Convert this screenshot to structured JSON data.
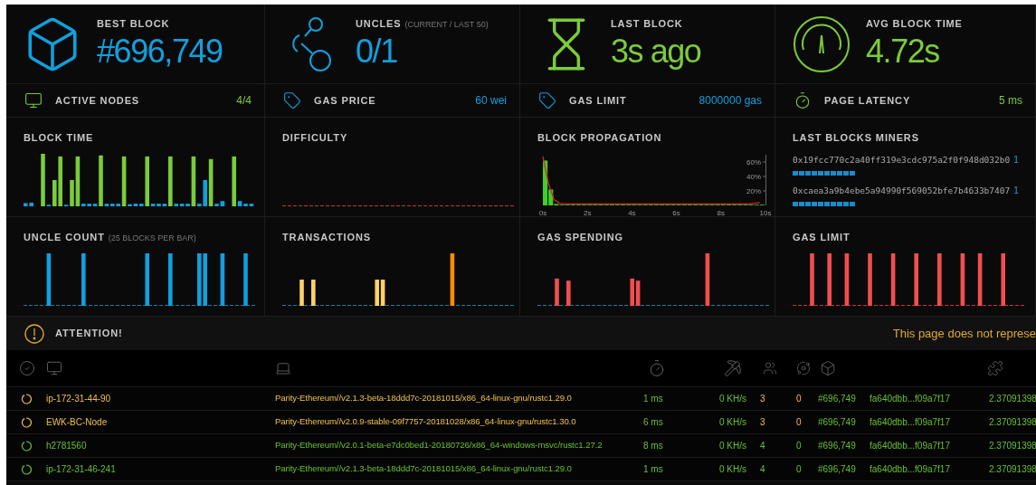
{
  "stats": [
    {
      "label": "BEST BLOCK",
      "value": "#696,749",
      "color": "#10a0de"
    },
    {
      "label": "UNCLES",
      "note": "(CURRENT / LAST 50)",
      "value": "0/1",
      "color": "#10a0de"
    },
    {
      "label": "LAST BLOCK",
      "value": "3s ago",
      "color": "#7bcc3a"
    },
    {
      "label": "AVG BLOCK TIME",
      "value": "4.72s",
      "color": "#7bcc3a"
    }
  ],
  "small_stats": [
    {
      "label": "ACTIVE NODES",
      "value": "4/4",
      "color": "#7bcc3a"
    },
    {
      "label": "GAS PRICE",
      "value": "60 wei",
      "color": "#10a0de"
    },
    {
      "label": "GAS LIMIT",
      "value": "8000000 gas",
      "color": "#10a0de"
    },
    {
      "label": "PAGE LATENCY",
      "value": "5 ms",
      "color": "#7bcc3a"
    }
  ],
  "charts": [
    {
      "kind": "bars",
      "title": "BLOCK TIME"
    },
    {
      "kind": "bars",
      "title": "DIFFICULTY"
    },
    {
      "kind": "propagation",
      "title": "BLOCK PROPAGATION",
      "chart_data": {
        "type": "bar",
        "xlim": [
          0,
          10
        ],
        "ylim": [
          0,
          70
        ],
        "xticks": [
          {
            "value": 0,
            "label": "0s"
          },
          {
            "value": 2,
            "label": "2s"
          },
          {
            "value": 4,
            "label": "4s"
          },
          {
            "value": 6,
            "label": "6s"
          },
          {
            "value": 8,
            "label": "8s"
          },
          {
            "value": 10,
            "label": "10s"
          }
        ],
        "yticks": [
          {
            "value": 20,
            "label": "20%"
          },
          {
            "value": 40,
            "label": "40%"
          },
          {
            "value": 60,
            "label": "60%"
          }
        ],
        "x": [
          0,
          0.25,
          0.5,
          0.75,
          1,
          1.25,
          1.5,
          1.75,
          2,
          2.25,
          2.5,
          2.75,
          3,
          3.25,
          3.5,
          3.75,
          4,
          4.25,
          4.5,
          4.75,
          5,
          5.25,
          5.5,
          5.75,
          6,
          6.25,
          6.5,
          6.75,
          7,
          7.25,
          7.5,
          7.75,
          8,
          8.25,
          8.5,
          8.75,
          9,
          9.25,
          9.5,
          9.75
        ],
        "series": [
          {
            "type": "bar",
            "color": "#3fcf2a",
            "values": [
              62,
              22,
              2,
              1,
              1,
              1,
              1,
              1,
              1,
              1,
              1,
              1,
              1,
              1,
              1,
              1,
              1,
              1,
              1,
              1,
              1,
              1,
              1,
              1,
              1,
              1,
              1,
              1,
              1,
              1,
              1,
              1,
              1,
              1,
              1,
              1,
              1,
              1,
              1,
              1
            ]
          },
          {
            "type": "line",
            "color": "#e02020",
            "values": [
              68,
              30,
              8,
              3,
              2,
              2,
              2,
              2,
              2,
              2,
              2,
              2,
              2,
              2,
              2,
              2,
              2,
              2,
              2,
              2,
              2,
              2,
              2,
              2,
              2,
              2,
              2,
              2,
              2,
              2,
              2,
              2,
              2,
              2,
              2,
              2,
              2,
              2,
              3,
              4
            ]
          }
        ]
      }
    },
    {
      "kind": "miners",
      "title": "LAST BLOCKS MINERS",
      "miners": [
        {
          "address": "0x19fcc770c2a40ff319e3cdc975a2f0f948d032b0",
          "count": "1"
        },
        {
          "address": "0xcaea3a9b4ebe5a94990f569052bfe7b4633b7407",
          "count": "1"
        }
      ]
    },
    {
      "kind": "bars",
      "title": "UNCLE COUNT",
      "note": "(25 BLOCKS PER BAR)"
    },
    {
      "kind": "bars",
      "title": "TRANSACTIONS"
    },
    {
      "kind": "bars",
      "title": "GAS SPENDING"
    },
    {
      "kind": "bars",
      "title": "GAS LIMIT"
    }
  ],
  "attention": {
    "title": "ATTENTION!",
    "message": "This page does not represe"
  },
  "table": {
    "rows": [
      {
        "name": "ip-172-31-44-90",
        "client": "Parity-Ethereum//v2.1.3-beta-18ddd7c-20181015/x86_64-linux-gnu/rustc1.29.0",
        "latency": "1 ms",
        "hashrate": "0 KH/s",
        "peers": "3",
        "pending": "0",
        "block": "#696,749",
        "hash": "fa640dbb...f09a7f17",
        "column_10": "2.37091398",
        "color": "#f0c14b"
      },
      {
        "name": "EWK-BC-Node",
        "client": "Parity-Ethereum//v2.0.9-stable-09f7757-20181028/x86_64-linux-gnu/rustc1.30.0",
        "latency": "6 ms",
        "hashrate": "0 KH/s",
        "peers": "3",
        "pending": "0",
        "block": "#696,749",
        "hash": "fa640dbb...f09a7f17",
        "column_10": "2.37091398",
        "color": "#f0c14b"
      },
      {
        "name": "h2781560",
        "client": "Parity-Ethereum//v2.0.1-beta-e7dc0bed1-20180726/x86_64-windows-msvc/rustc1.27.2",
        "latency": "8 ms",
        "hashrate": "0 KH/s",
        "peers": "4",
        "pending": "0",
        "block": "#696,749",
        "hash": "fa640dbb...f09a7f17",
        "column_10": "2.37091398",
        "color": "#6ac12f"
      },
      {
        "name": "ip-172-31-46-241",
        "client": "Parity-Ethereum//v2.1.3-beta-18ddd7c-20181015/x86_64-linux-gnu/rustc1.29.0",
        "latency": "1 ms",
        "hashrate": "0 KH/s",
        "peers": "4",
        "pending": "0",
        "block": "#696,749",
        "hash": "fa640dbb...f09a7f17",
        "column_10": "2.37091398",
        "color": "#6ac12f"
      }
    ]
  }
}
